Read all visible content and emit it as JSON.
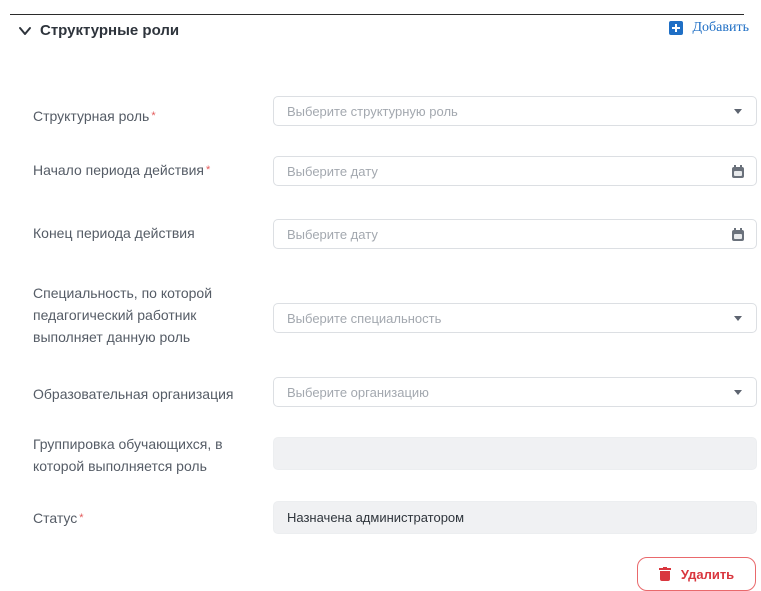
{
  "section": {
    "title": "Структурные роли",
    "add_label": "Добавить"
  },
  "fields": [
    {
      "label": "Структурная роль",
      "required": "*",
      "placeholder": "Выберите структурную роль",
      "control": "select"
    },
    {
      "label": "Начало периода действия",
      "required": "*",
      "placeholder": "Выберите дату",
      "control": "date"
    },
    {
      "label": "Конец периода действия",
      "required": "",
      "placeholder": "Выберите дату",
      "control": "date"
    },
    {
      "label": "Специальность, по которой педагогический работник выполняет данную роль",
      "required": "",
      "placeholder": "Выберите специальность",
      "control": "select"
    },
    {
      "label": "Образовательная организация",
      "required": "",
      "placeholder": "Выберите организацию",
      "control": "select"
    },
    {
      "label": "Группировка обучающихся, в которой выполняется роль",
      "required": "",
      "value": "",
      "control": "readonly"
    },
    {
      "label": "Статус",
      "required": "*",
      "value": "Назначена администратором",
      "control": "readonly"
    }
  ],
  "actions": {
    "delete_label": "Удалить"
  },
  "colors": {
    "accent": "#1f6fc5",
    "required": "#e35a5a",
    "danger": "#d9363e"
  },
  "icons": {
    "collapse": "chevron-down-icon",
    "add": "plus-square-icon",
    "select": "caret-down-icon",
    "date": "calendar-icon",
    "delete": "trash-icon"
  }
}
